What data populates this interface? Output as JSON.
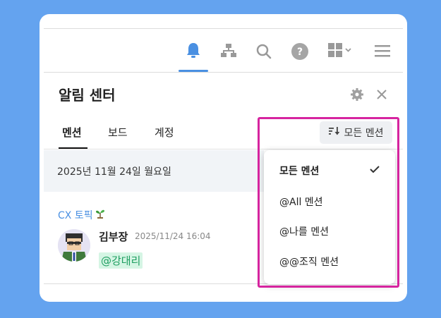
{
  "panel": {
    "title": "알림 센터",
    "tabs": [
      {
        "label": "멘션",
        "active": true
      },
      {
        "label": "보드",
        "active": false
      },
      {
        "label": "계정",
        "active": false
      }
    ]
  },
  "toolbar": {
    "icons": [
      "bell-icon",
      "org-chart-icon",
      "search-icon",
      "help-icon",
      "apps-grid-icon",
      "chevron-down-icon",
      "menu-icon"
    ],
    "active_icon": "bell-icon"
  },
  "filter": {
    "label": "모든 멘션",
    "options": [
      {
        "label": "모든 멘션",
        "selected": true
      },
      {
        "label": "@All 멘션",
        "selected": false
      },
      {
        "label": "@나를 멘션",
        "selected": false
      },
      {
        "label": "@@조직 멘션",
        "selected": false
      }
    ]
  },
  "feed": {
    "date_header": "2025년 11월 24일 월요일",
    "items": [
      {
        "topic": "CX 토픽",
        "author": "김부장",
        "timestamp": "2025/11/24 16:04",
        "mention": "@강대리"
      }
    ]
  },
  "colors": {
    "background": "#64a3ef",
    "accent": "#4a90e2",
    "highlight": "#d6249f",
    "mention_bg": "#d5f5e4",
    "mention_text": "#1e9e60"
  }
}
